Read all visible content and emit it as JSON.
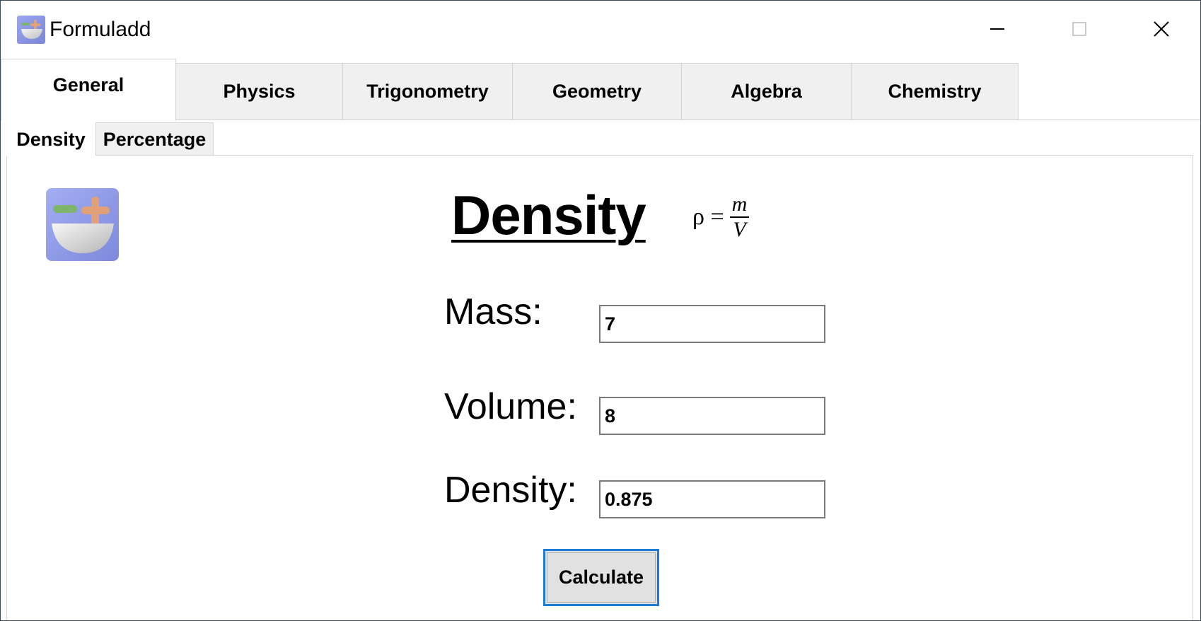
{
  "window": {
    "title": "Formuladd",
    "icon": "formuladd-app-icon"
  },
  "tabs": [
    {
      "label": "General",
      "active": true
    },
    {
      "label": "Physics",
      "active": false
    },
    {
      "label": "Trigonometry",
      "active": false
    },
    {
      "label": "Geometry",
      "active": false
    },
    {
      "label": "Algebra",
      "active": false
    },
    {
      "label": "Chemistry",
      "active": false
    }
  ],
  "subtabs": [
    {
      "label": "Density",
      "active": true
    },
    {
      "label": "Percentage",
      "active": false
    }
  ],
  "content": {
    "heading": "Density",
    "formula": {
      "lhs": "ρ =",
      "numerator": "m",
      "denominator": "V"
    },
    "fields": [
      {
        "label": "Mass:",
        "value": "7"
      },
      {
        "label": "Volume:",
        "value": "8"
      },
      {
        "label": "Density:",
        "value": "0.875"
      }
    ],
    "button_label": "Calculate"
  },
  "colors": {
    "focus_border": "#1e7bd6",
    "tab_inactive_bg": "#f0f0f0",
    "logo_bg": "#8a97e6",
    "logo_minus": "#7fb56b",
    "logo_plus": "#e0a179"
  }
}
